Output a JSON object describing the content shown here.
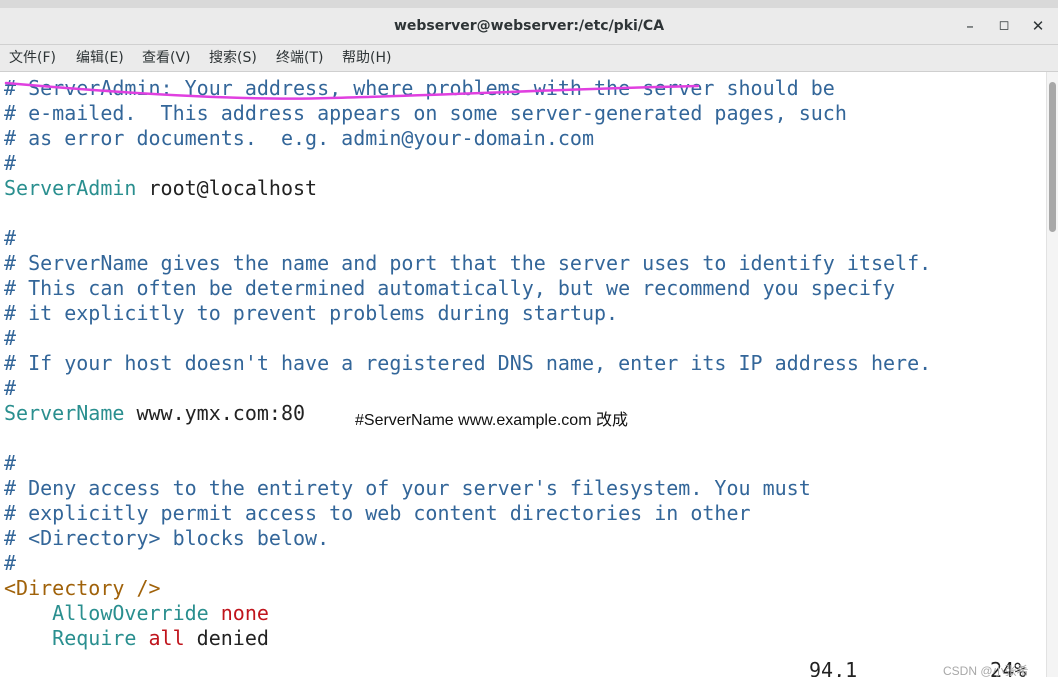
{
  "window": {
    "title": "webserver@webserver:/etc/pki/CA",
    "minimize": "–",
    "maximize": "◻",
    "close": "✕"
  },
  "menu": [
    "文件(F)",
    "编辑(E)",
    "查看(V)",
    "搜索(S)",
    "终端(T)",
    "帮助(H)"
  ],
  "terminal": {
    "lines": [
      "# ServerAdmin: Your address, where problems with the server should be",
      "# e-mailed.  This address appears on some server-generated pages, such",
      "# as error documents.  e.g. admin@your-domain.com",
      "#",
      "ServerAdmin",
      " root@localhost",
      "",
      "#",
      "# ServerName gives the name and port that the server uses to identify itself.",
      "# This can often be determined automatically, but we recommend you specify",
      "# it explicitly to prevent problems during startup.",
      "#",
      "# If your host doesn't have a registered DNS name, enter its IP address here.",
      "#",
      "ServerName",
      " www.ymx.com:80",
      "",
      "#",
      "# Deny access to the entirety of your server's filesystem. You must",
      "# explicitly permit access to web content directories in other",
      "# <Directory> blocks below.",
      "#",
      "<Directory />",
      "    AllowOverride",
      " none",
      "    Require",
      " all",
      " denied"
    ],
    "annotation": "#ServerName www.example.com 改成",
    "cursor_position": "94,1",
    "scroll_percent": "24%"
  },
  "watermark": "CSDN @小张希",
  "colors": {
    "comment": "#336699",
    "keyword": "#2a8f8f",
    "text": "#222222",
    "tag": "#a0620a",
    "value": "#c0141c",
    "annotation_underline": "#e040e0"
  }
}
